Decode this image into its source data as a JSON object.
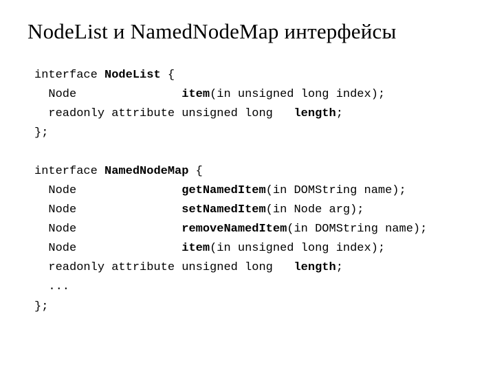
{
  "title": "NodeList и NamedNodeMap интерфейсы",
  "code1": {
    "l1a": "interface ",
    "l1b": "NodeList",
    "l1c": " {",
    "l2a": "  Node               ",
    "l2b": "item",
    "l2c": "(in unsigned long index);",
    "l3a": "  readonly attribute unsigned long   ",
    "l3b": "length",
    "l3c": ";",
    "l4a": "};"
  },
  "code2": {
    "l1a": "interface ",
    "l1b": "NamedNodeMap",
    "l1c": " {",
    "l2a": "  Node               ",
    "l2b": "getNamedItem",
    "l2c": "(in DOMString name);",
    "l3a": "  Node               ",
    "l3b": "setNamedItem",
    "l3c": "(in Node arg);",
    "l4a": "  Node               ",
    "l4b": "removeNamedItem",
    "l4c": "(in DOMString name);",
    "l5a": "  Node               ",
    "l5b": "item",
    "l5c": "(in unsigned long index);",
    "l6a": "  readonly attribute unsigned long   ",
    "l6b": "length",
    "l6c": ";",
    "l7a": "  ...",
    "l8a": "};"
  }
}
